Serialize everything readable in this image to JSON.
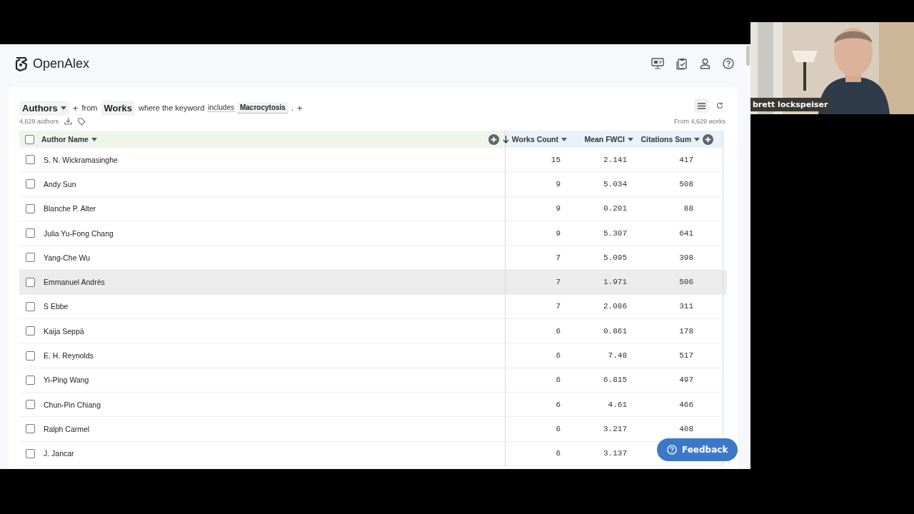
{
  "app": {
    "brand": "OpenAlex",
    "query": {
      "entity": "Authors",
      "from_label": "from",
      "source": "Works",
      "phrase": "where the keyword",
      "operator": "includes",
      "value": "Macrocytosis",
      "end": ".",
      "add": "+"
    },
    "result_count": "4,629 authors",
    "source_count": "From 4,629 works",
    "table": {
      "select_all": {
        "checked": false
      },
      "columns": [
        {
          "label": "Author Name",
          "kind": "name",
          "sorted": false
        },
        {
          "label": "Works Count",
          "kind": "metric",
          "sorted": true
        },
        {
          "label": "Mean FWCI",
          "kind": "metric",
          "sorted": false
        },
        {
          "label": "Citations Sum",
          "kind": "metric",
          "sorted": false
        }
      ],
      "rows": [
        {
          "checked": false,
          "hovered": false,
          "cells": [
            "S. N. Wickramasinghe",
            "15",
            "2.141",
            "417"
          ]
        },
        {
          "checked": false,
          "hovered": false,
          "cells": [
            "Andy Sun",
            "9",
            "5.034",
            "508"
          ]
        },
        {
          "checked": false,
          "hovered": false,
          "cells": [
            "Blanche P. Alter",
            "9",
            "0.201",
            "88"
          ]
        },
        {
          "checked": false,
          "hovered": false,
          "cells": [
            "Julia Yu-Fong Chang",
            "9",
            "5.307",
            "641"
          ]
        },
        {
          "checked": false,
          "hovered": false,
          "cells": [
            "Yang-Che Wu",
            "7",
            "5.095",
            "398"
          ]
        },
        {
          "checked": false,
          "hovered": true,
          "cells": [
            "Emmanuel Andrès",
            "7",
            "1.971",
            "506"
          ]
        },
        {
          "checked": false,
          "hovered": false,
          "cells": [
            "S Ebbe",
            "7",
            "2.086",
            "311"
          ]
        },
        {
          "checked": false,
          "hovered": false,
          "cells": [
            "Kaija Seppä",
            "6",
            "0.861",
            "178"
          ]
        },
        {
          "checked": false,
          "hovered": false,
          "cells": [
            "E. H. Reynolds",
            "6",
            "7.48",
            "517"
          ]
        },
        {
          "checked": false,
          "hovered": false,
          "cells": [
            "Yi-Ping Wang",
            "6",
            "6.815",
            "497"
          ]
        },
        {
          "checked": false,
          "hovered": false,
          "cells": [
            "Chun-Pin Chiang",
            "6",
            "4.61",
            "466"
          ]
        },
        {
          "checked": false,
          "hovered": false,
          "cells": [
            "Ralph Carmel",
            "6",
            "3.217",
            "408"
          ]
        },
        {
          "checked": false,
          "hovered": false,
          "cells": [
            "J. Jancar",
            "6",
            "3.137"
          ]
        }
      ]
    },
    "feedback": "Feedback"
  },
  "video_tile": {
    "participant": "brett lockspeiser",
    "kind": "picture"
  }
}
